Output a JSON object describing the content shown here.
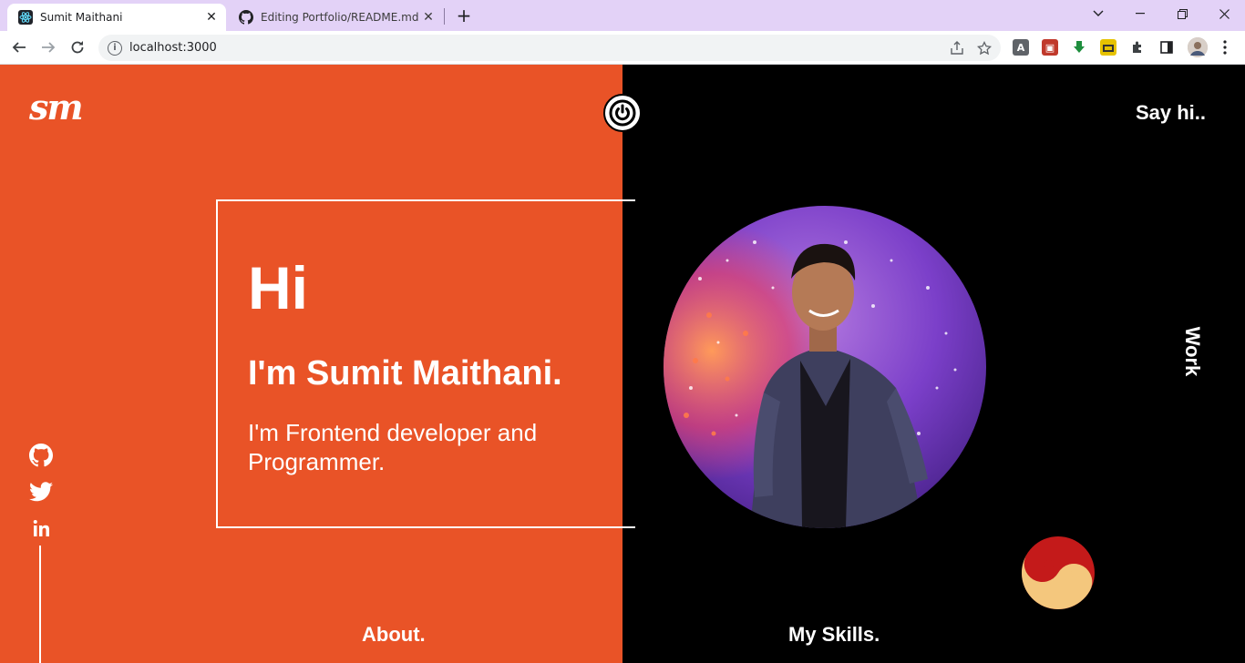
{
  "browser": {
    "tabs": [
      {
        "title": "Sumit Maithani",
        "active": true,
        "icon": "react-icon"
      },
      {
        "title": "Editing Portfolio/README.md at",
        "active": false,
        "icon": "github-icon"
      }
    ],
    "url": "localhost:3000"
  },
  "page": {
    "logo": "sm",
    "say_hi": "Say hi..",
    "work": "Work",
    "intro": {
      "hi": "Hi",
      "name": "I'm Sumit Maithani.",
      "role": "I'm Frontend developer and Programmer."
    },
    "about": "About.",
    "skills": "My Skills.",
    "social": [
      "github-icon",
      "twitter-icon",
      "linkedin-icon"
    ],
    "colors": {
      "left_bg": "#e95327",
      "right_bg": "#000000",
      "text": "#ffffff"
    }
  }
}
